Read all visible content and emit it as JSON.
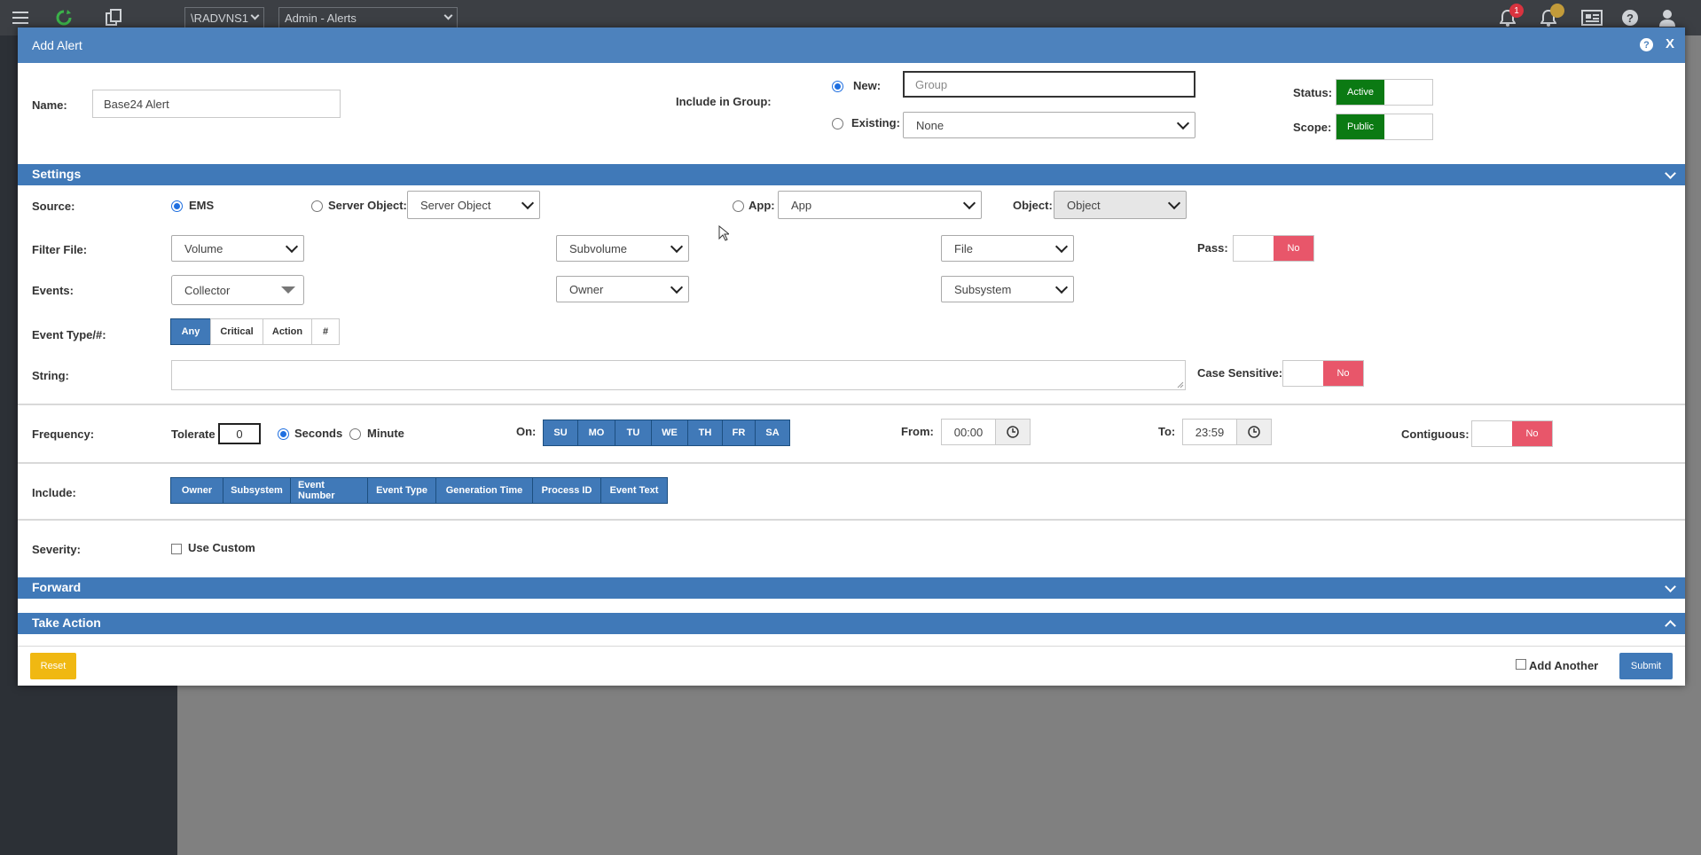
{
  "topbar": {
    "server_select": "\\RADVNS1",
    "page_select": "Admin - Alerts",
    "notif_count": "1",
    "icons": [
      "menu-icon",
      "refresh-icon",
      "copy-icon",
      "bell-icon",
      "bell-icon",
      "news-icon",
      "help-icon",
      "user-icon"
    ]
  },
  "modal": {
    "title": "Add Alert",
    "help": "?",
    "close": "X",
    "name_label": "Name:",
    "name_value": "Base24 Alert",
    "group_label": "Include in Group:",
    "new_label": "New:",
    "new_placeholder": "Group",
    "existing_label": "Existing:",
    "existing_value": "None",
    "status_label": "Status:",
    "status_value": "Active",
    "scope_label": "Scope:",
    "scope_value": "Public"
  },
  "settings": {
    "title": "Settings",
    "source_label": "Source:",
    "ems": "EMS",
    "server_object_label": "Server Object:",
    "server_object_value": "Server Object",
    "app_label": "App:",
    "app_value": "App",
    "object_label": "Object:",
    "object_value": "Object",
    "filter_label": "Filter File:",
    "volume": "Volume",
    "subvolume": "Subvolume",
    "file": "File",
    "pass_label": "Pass:",
    "pass_value": "No",
    "events_label": "Events:",
    "collector": "Collector",
    "owner": "Owner",
    "subsystem": "Subsystem",
    "event_type_label": "Event Type/#:",
    "event_types": [
      "Any",
      "Critical",
      "Action",
      "#"
    ],
    "string_label": "String:",
    "case_label": "Case Sensitive:",
    "case_value": "No",
    "frequency_label": "Frequency:",
    "tolerate_label": "Tolerate",
    "tolerate_value": "0",
    "seconds": "Seconds",
    "minute": "Minute",
    "on_label": "On:",
    "days": [
      "SU",
      "MO",
      "TU",
      "WE",
      "TH",
      "FR",
      "SA"
    ],
    "from_label": "From:",
    "from_value": "00:00",
    "to_label": "To:",
    "to_value": "23:59",
    "contiguous_label": "Contiguous:",
    "contiguous_value": "No",
    "include_label": "Include:",
    "include_items": [
      "Owner",
      "Subsystem",
      "Event Number",
      "Event Type",
      "Generation Time",
      "Process ID",
      "Event Text"
    ],
    "severity_label": "Severity:",
    "use_custom": "Use Custom"
  },
  "forward": {
    "title": "Forward"
  },
  "take_action": {
    "title": "Take Action"
  },
  "footer": {
    "reset": "Reset",
    "add_another": "Add Another",
    "submit": "Submit"
  },
  "colors": {
    "header": "#4d82bd",
    "section": "#4079b8",
    "active": "#0b7a13",
    "no": "#e8566a",
    "reset": "#f0b812"
  }
}
